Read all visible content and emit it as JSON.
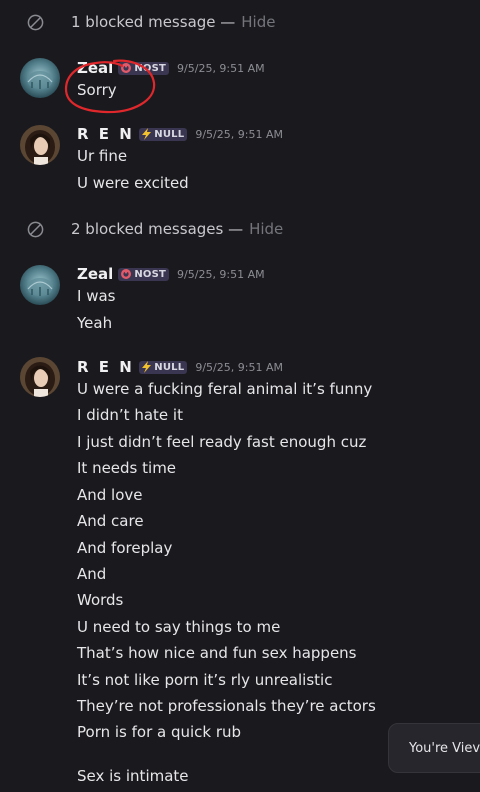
{
  "blocked_1": {
    "text": "1 blocked message —",
    "action": "Hide"
  },
  "blocked_2": {
    "text": "2 blocked messages —",
    "action": "Hide"
  },
  "msg_group_1": {
    "author": "Zeal",
    "tag": "NOST",
    "timestamp": "9/5/25, 9:51 AM",
    "lines": [
      "Sorry"
    ]
  },
  "msg_group_2": {
    "author": "R E N",
    "tag": "NULL",
    "timestamp": "9/5/25, 9:51 AM",
    "lines": [
      "Ur fine",
      "U were excited"
    ]
  },
  "msg_group_3": {
    "author": "Zeal",
    "tag": "NOST",
    "timestamp": "9/5/25, 9:51 AM",
    "lines": [
      "I was",
      "Yeah"
    ]
  },
  "msg_group_4": {
    "author": "R E N",
    "tag": "NULL",
    "timestamp": "9/5/25, 9:51 AM",
    "lines": [
      "U were a fucking feral animal it’s funny",
      "I didn’t hate it",
      "I just didn’t feel ready fast enough cuz",
      "It needs time",
      "And love",
      "And care",
      "And foreplay",
      "And",
      "Words",
      "U need to say things to me",
      "That’s how nice and fun sex happens",
      "It’s not like porn it’s rly unrealistic",
      "They’re not professionals they’re actors",
      "Porn is for a quick rub",
      "Sex is intimate"
    ]
  },
  "toast": {
    "text": "You're Viev"
  },
  "colors": {
    "background": "#1a1a1e",
    "tag_background": "#3a3550",
    "hide_link": "#74747c",
    "annotation_circle": "#e0282c",
    "nost_icon": "#e05a6a",
    "null_icon": "#f2c12e"
  }
}
